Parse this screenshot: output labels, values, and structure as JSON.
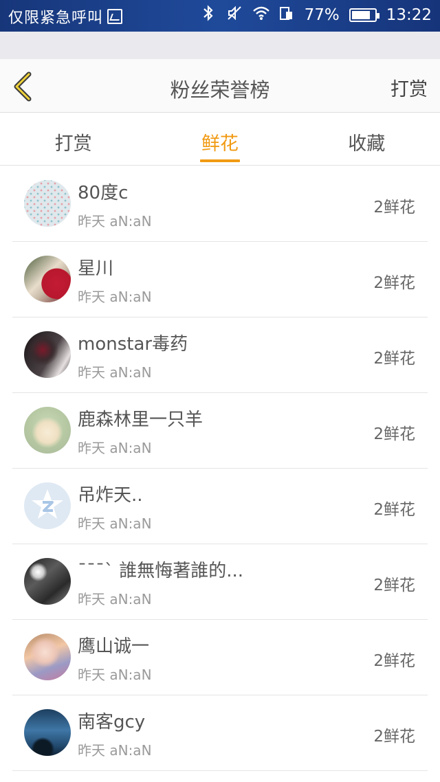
{
  "status_bar": {
    "carrier_text": "仅限紧急呼叫",
    "battery_percent": "77%",
    "time": "13:22",
    "icons": [
      "image-icon",
      "bluetooth-icon",
      "mute-icon",
      "wifi-icon",
      "sim-icon",
      "battery-icon"
    ]
  },
  "header": {
    "title": "粉丝荣誉榜",
    "action_label": "打赏",
    "back_icon": "chevron-left-icon",
    "accent_color": "#f19a12"
  },
  "tabs": [
    {
      "label": "打赏"
    },
    {
      "label": "鲜花"
    },
    {
      "label": "收藏"
    }
  ],
  "active_tab": "鲜花",
  "fans": [
    {
      "name": "80度c",
      "time": "昨天 aN:aN",
      "gift": "2鲜花"
    },
    {
      "name": "星川",
      "time": "昨天 aN:aN",
      "gift": "2鲜花"
    },
    {
      "name": "monstar毒药",
      "time": "昨天 aN:aN",
      "gift": "2鲜花"
    },
    {
      "name": "鹿森林里一只羊",
      "time": "昨天 aN:aN",
      "gift": "2鲜花"
    },
    {
      "name": "吊炸天..",
      "time": "昨天 aN:aN",
      "gift": "2鲜花"
    },
    {
      "name": "ˉˉˉˋ 誰無悔著誰的...",
      "time": "昨天 aN:aN",
      "gift": "2鲜花"
    },
    {
      "name": "鹰山诚一",
      "time": "昨天 aN:aN",
      "gift": "2鲜花"
    },
    {
      "name": "南客gcy",
      "time": "昨天 aN:aN",
      "gift": "2鲜花"
    }
  ]
}
